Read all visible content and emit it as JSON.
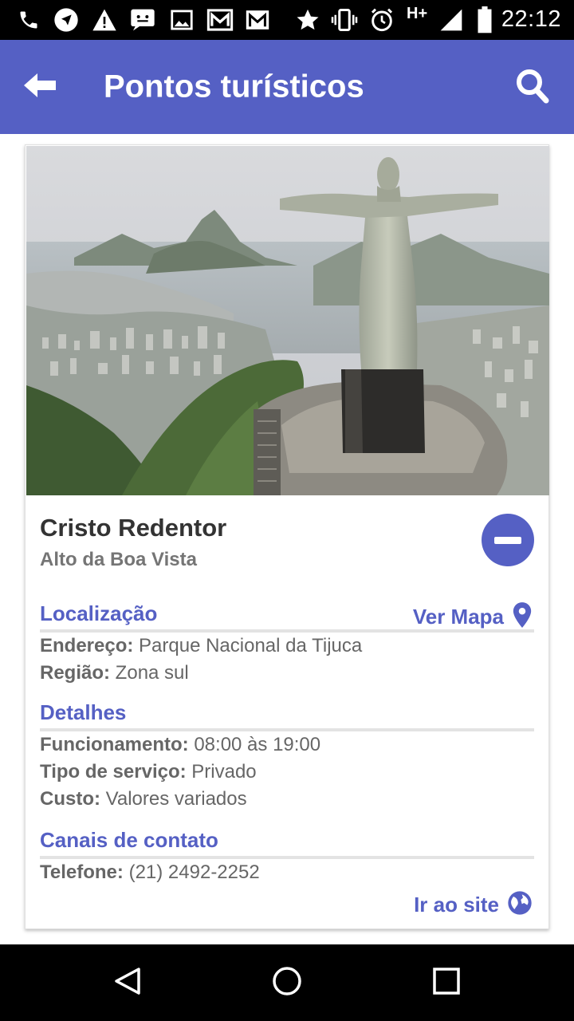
{
  "status_bar": {
    "time": "22:12",
    "network": "H+",
    "icons": [
      "phone-icon",
      "navigation-icon",
      "warning-icon",
      "message-icon",
      "image-icon",
      "gmail-icon",
      "gmail-icon",
      "star-icon",
      "vibrate-icon",
      "alarm-icon",
      "signal-icon",
      "battery-icon"
    ]
  },
  "app_bar": {
    "title": "Pontos turísticos",
    "back_icon": "arrow-left-icon",
    "search_icon": "search-icon",
    "color": "#5560c4"
  },
  "place": {
    "name": "Cristo Redentor",
    "subtitle": "Alto da Boa Vista",
    "photo": "Christ the Redeemer statue overlooking Rio de Janeiro",
    "remove_icon": "minus-circle-icon"
  },
  "sections": {
    "location": {
      "title": "Localização",
      "map_link": "Ver Mapa",
      "map_icon": "map-pin-icon",
      "address_label": "Endereço:",
      "address_value": " Parque Nacional da Tijuca",
      "region_label": "Região:",
      "region_value": " Zona sul"
    },
    "details": {
      "title": "Detalhes",
      "hours_label": "Funcionamento:",
      "hours_value": " 08:00 às 19:00",
      "service_label": "Tipo de serviço:",
      "service_value": " Privado",
      "cost_label": "Custo:",
      "cost_value": " Valores variados"
    },
    "contact": {
      "title": "Canais de contato",
      "phone_label": "Telefone:",
      "phone_value": " (21) 2492-2252",
      "site_link": "Ir ao site",
      "site_icon": "globe-icon"
    }
  },
  "nav_bar": {
    "back_icon": "triangle-back-icon",
    "home_icon": "circle-home-icon",
    "recents_icon": "square-recents-icon"
  },
  "colors": {
    "accent": "#5560c4",
    "status_bar": "#000000",
    "text_dark": "#333333",
    "text_muted": "#666666"
  }
}
